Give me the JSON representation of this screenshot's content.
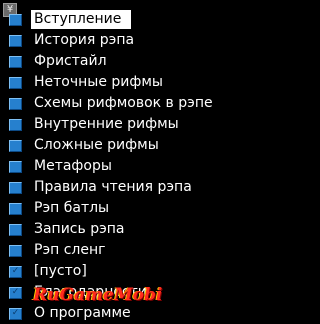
{
  "app": {
    "icon_name": "app-icon",
    "icon_glyph": "¥"
  },
  "menu": {
    "selected_index": 0,
    "items": [
      {
        "label": "Вступление",
        "marker": "checkbox-icon"
      },
      {
        "label": "История рэпа",
        "marker": "checkbox-icon"
      },
      {
        "label": "Фристайл",
        "marker": "checkbox-icon"
      },
      {
        "label": "Неточные рифмы",
        "marker": "checkbox-icon"
      },
      {
        "label": "Схемы рифмовок в рэпе",
        "marker": "checkbox-icon"
      },
      {
        "label": "Внутренние рифмы",
        "marker": "checkbox-icon"
      },
      {
        "label": "Сложные рифмы",
        "marker": "checkbox-icon"
      },
      {
        "label": "Метафоры",
        "marker": "checkbox-icon"
      },
      {
        "label": "Правила чтения рэпа",
        "marker": "checkbox-icon"
      },
      {
        "label": "Рэп батлы",
        "marker": "checkbox-icon"
      },
      {
        "label": "Запись рэпа",
        "marker": "checkbox-icon"
      },
      {
        "label": "Рэп сленг",
        "marker": "checkbox-icon"
      },
      {
        "label": "[пусто]",
        "marker": "checkmark-icon"
      },
      {
        "label": "Благодарности",
        "marker": "checkmark-icon"
      },
      {
        "label": "О программе",
        "marker": "checkmark-icon"
      }
    ]
  },
  "watermark": {
    "text": "RuGameMobi"
  },
  "colors": {
    "background": "#000000",
    "text": "#ffffff",
    "selection_background": "#ffffff",
    "selection_text": "#000000",
    "checkbox": "#2680ce",
    "watermark": "#ff2a1e"
  }
}
